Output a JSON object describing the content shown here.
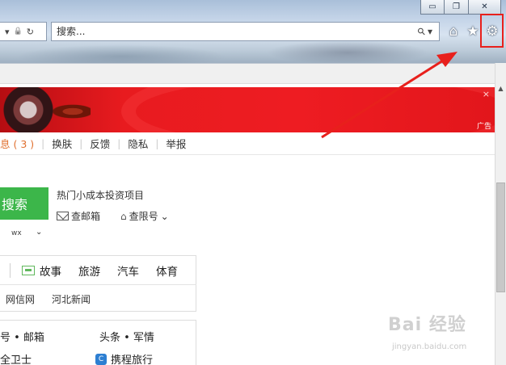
{
  "window": {
    "minimize_glyph": "▭",
    "restore_glyph": "❐",
    "close_glyph": "✕"
  },
  "address": {
    "dropdown_glyph": "▾",
    "lock_glyph": "🔒",
    "refresh_glyph": "↻"
  },
  "search": {
    "placeholder": "搜索...",
    "search_glyph": "⚲",
    "dropdown_glyph": "▾"
  },
  "toolbar": {
    "home_glyph": "⌂",
    "favorites_glyph": "★",
    "tools_glyph": "⚙"
  },
  "banner": {
    "close_glyph": "×",
    "ad_label": "广告"
  },
  "top_links": {
    "messages": "息 ( 3 )",
    "skin": "换肤",
    "feedback": "反馈",
    "privacy": "隐私",
    "report": "举报",
    "separator": "|"
  },
  "search_area": {
    "button_label": "搜索",
    "hot_title": "热门小成本投资项目",
    "mail_link": "查邮箱",
    "limit_link": "查限号",
    "limit_chevron": "⌄",
    "suggestion": "wx",
    "suggestion_chevron": "⌄"
  },
  "nav": {
    "row1": [
      "故事",
      "旅游",
      "汽车",
      "体育"
    ],
    "row2": [
      "网信网",
      "河北新闻"
    ]
  },
  "list": {
    "item1": "号 • 邮箱",
    "item2": "头条 • 军情",
    "item3": "全卫士",
    "item4": "携程旅行",
    "ctrip_icon_glyph": "C"
  },
  "scrollbar": {
    "up_glyph": "▲"
  },
  "watermark": {
    "main": "Bai 经验",
    "sub": "jingyan.baidu.com"
  },
  "colors": {
    "highlight_red": "#e8201c",
    "search_green": "#3cb64a",
    "banner_red": "#ee1c22",
    "message_orange": "#e0702f"
  }
}
